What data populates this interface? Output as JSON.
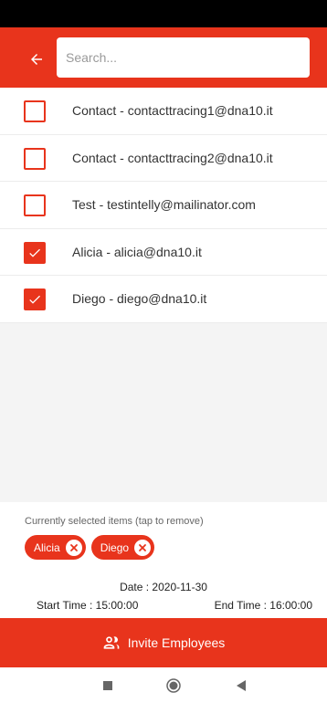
{
  "header": {
    "search_placeholder": "Search..."
  },
  "contacts": [
    {
      "label": "Contact - contacttracing1@dna10.it",
      "checked": false
    },
    {
      "label": "Contact - contacttracing2@dna10.it",
      "checked": false
    },
    {
      "label": "Test - testintelly@mailinator.com",
      "checked": false
    },
    {
      "label": "Alicia - alicia@dna10.it",
      "checked": true
    },
    {
      "label": "Diego - diego@dna10.it",
      "checked": true
    }
  ],
  "selection": {
    "caption": "Currently selected items (tap to remove)",
    "chips": [
      "Alicia",
      "Diego"
    ]
  },
  "schedule": {
    "date": "Date : 2020-11-30",
    "start_time": "Start Time : 15:00:00",
    "end_time": "End Time : 16:00:00"
  },
  "action": {
    "invite_label": "Invite Employees",
    "icon": "users-icon"
  },
  "colors": {
    "accent": "#e8341c"
  }
}
